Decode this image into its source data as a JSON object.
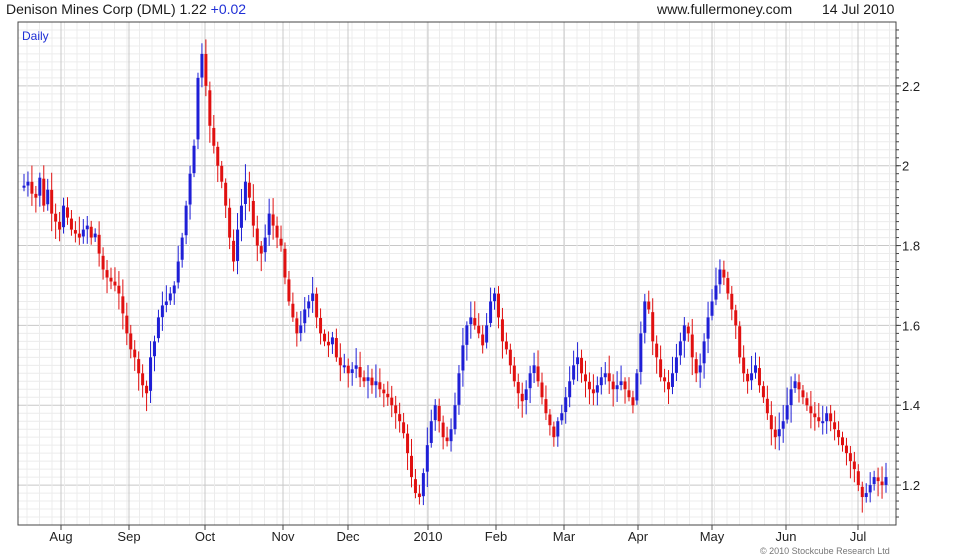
{
  "header": {
    "name": "Denison Mines Corp (DML)",
    "price": "1.22",
    "change": "+0.02",
    "site": "www.fullermoney.com",
    "date": "14 Jul 2010"
  },
  "copyright": "© 2010 Stockcube Research Ltd",
  "colors": {
    "up": "#1f1fd6",
    "down": "#e01010",
    "grid_major": "#c8c8c8",
    "grid_minor": "#ececec",
    "frame": "#444444",
    "period_label": "#1f2fd6"
  },
  "chart_data": {
    "type": "candlestick",
    "period_label": "Daily",
    "ylim": [
      1.1,
      2.36
    ],
    "y_ticks": [
      1.2,
      1.4,
      1.6,
      1.8,
      2.0,
      2.2
    ],
    "y_tick_labels": [
      "1.2",
      "1.4",
      "1.6",
      "1.8",
      "2",
      "2.2"
    ],
    "x_labels": [
      "Aug",
      "Sep",
      "Oct",
      "Nov",
      "Dec",
      "2010",
      "Feb",
      "Mar",
      "Apr",
      "May",
      "Jun",
      "Jul"
    ],
    "grid": true,
    "close": [
      1.95,
      1.96,
      1.93,
      1.92,
      1.97,
      1.9,
      1.94,
      1.88,
      1.86,
      1.84,
      1.9,
      1.87,
      1.84,
      1.83,
      1.82,
      1.84,
      1.85,
      1.82,
      1.83,
      1.78,
      1.74,
      1.72,
      1.71,
      1.7,
      1.68,
      1.63,
      1.58,
      1.54,
      1.52,
      1.48,
      1.45,
      1.43,
      1.52,
      1.56,
      1.62,
      1.65,
      1.66,
      1.68,
      1.7,
      1.76,
      1.82,
      1.9,
      1.98,
      2.05,
      2.22,
      2.28,
      2.2,
      2.1,
      2.05,
      2.0,
      1.96,
      1.9,
      1.82,
      1.76,
      1.84,
      1.9,
      1.96,
      1.92,
      1.85,
      1.8,
      1.78,
      1.82,
      1.88,
      1.85,
      1.82,
      1.8,
      1.72,
      1.66,
      1.62,
      1.58,
      1.6,
      1.64,
      1.66,
      1.68,
      1.62,
      1.58,
      1.56,
      1.55,
      1.57,
      1.52,
      1.5,
      1.5,
      1.48,
      1.49,
      1.5,
      1.47,
      1.46,
      1.47,
      1.45,
      1.46,
      1.44,
      1.43,
      1.42,
      1.4,
      1.38,
      1.36,
      1.33,
      1.28,
      1.22,
      1.18,
      1.17,
      1.23,
      1.3,
      1.36,
      1.4,
      1.36,
      1.32,
      1.31,
      1.34,
      1.4,
      1.48,
      1.55,
      1.6,
      1.62,
      1.6,
      1.58,
      1.55,
      1.6,
      1.66,
      1.68,
      1.62,
      1.56,
      1.54,
      1.5,
      1.46,
      1.43,
      1.41,
      1.44,
      1.48,
      1.5,
      1.46,
      1.42,
      1.38,
      1.35,
      1.32,
      1.36,
      1.38,
      1.42,
      1.46,
      1.5,
      1.52,
      1.48,
      1.46,
      1.44,
      1.43,
      1.45,
      1.47,
      1.48,
      1.46,
      1.44,
      1.45,
      1.46,
      1.44,
      1.42,
      1.4,
      1.48,
      1.58,
      1.66,
      1.64,
      1.56,
      1.52,
      1.47,
      1.46,
      1.44,
      1.48,
      1.52,
      1.56,
      1.6,
      1.58,
      1.52,
      1.48,
      1.5,
      1.56,
      1.62,
      1.66,
      1.7,
      1.74,
      1.72,
      1.68,
      1.64,
      1.6,
      1.52,
      1.48,
      1.46,
      1.48,
      1.5,
      1.45,
      1.42,
      1.38,
      1.34,
      1.32,
      1.34,
      1.36,
      1.4,
      1.44,
      1.46,
      1.44,
      1.42,
      1.4,
      1.38,
      1.37,
      1.36,
      1.36,
      1.38,
      1.36,
      1.34,
      1.32,
      1.3,
      1.28,
      1.26,
      1.24,
      1.2,
      1.17,
      1.18,
      1.2,
      1.22,
      1.21,
      1.2,
      1.22
    ]
  }
}
